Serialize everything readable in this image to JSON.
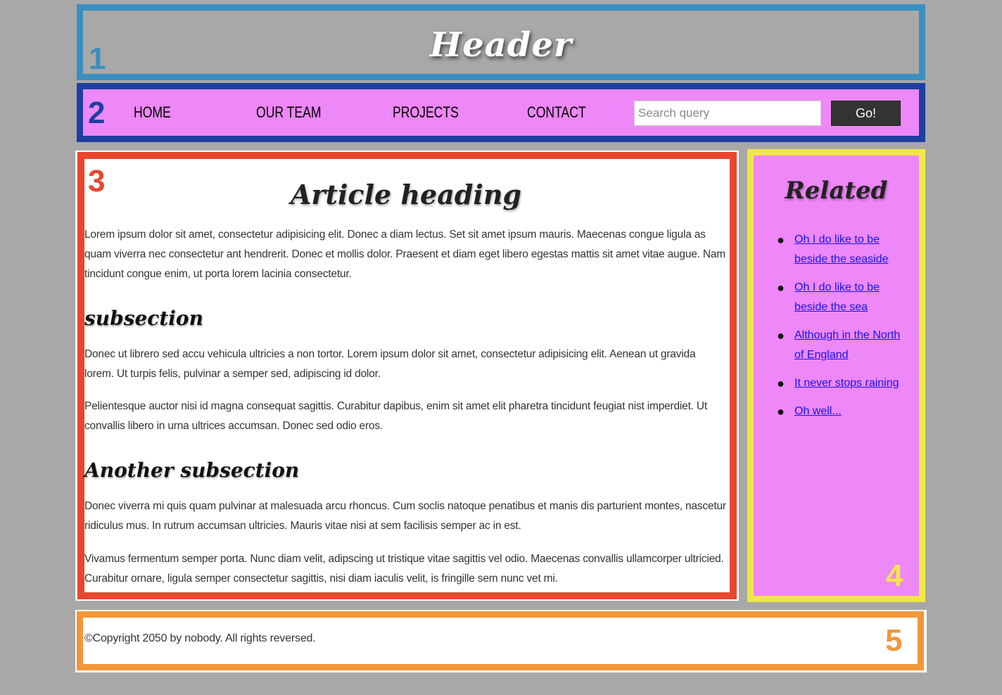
{
  "header": {
    "title": "Header",
    "region_number": "1"
  },
  "nav": {
    "region_number": "2",
    "links": [
      "HOME",
      "OUR TEAM",
      "PROJECTS",
      "CONTACT"
    ],
    "search_placeholder": "Search query",
    "search_value": "",
    "button_label": "Go!"
  },
  "article": {
    "region_number": "3",
    "title": "Article heading",
    "intro": "Lorem ipsum dolor sit amet, consectetur adipisicing elit. Donec a diam lectus. Set sit amet ipsum mauris. Maecenas congue ligula as quam viverra nec consectetur ant hendrerit. Donec et mollis dolor. Praesent et diam eget libero egestas mattis sit amet vitae augue. Nam tincidunt congue enim, ut porta lorem lacinia consectetur.",
    "subsection_1": {
      "title": "subsection",
      "paragraphs": [
        "Donec ut librero sed accu vehicula ultricies a non tortor. Lorem ipsum dolor sit amet, consectetur adipisicing elit. Aenean ut gravida lorem. Ut turpis felis, pulvinar a semper sed, adipiscing id dolor.",
        "Pelientesque auctor nisi id magna consequat sagittis. Curabitur dapibus, enim sit amet elit pharetra tincidunt feugiat nist imperdiet. Ut convallis libero in urna ultrices accumsan. Donec sed odio eros."
      ]
    },
    "subsection_2": {
      "title": "Another subsection",
      "paragraphs": [
        "Donec viverra mi quis quam pulvinar at malesuada arcu rhoncus. Cum soclis natoque penatibus et manis dis parturient montes, nascetur ridiculus mus. In rutrum accumsan ultricies. Mauris vitae nisi at sem facilisis semper ac in est.",
        "Vivamus fermentum semper porta. Nunc diam velit, adipscing ut tristique vitae sagittis vel odio. Maecenas convallis ullamcorper ultricied. Curabitur ornare, ligula semper consectetur sagittis, nisi diam iaculis velit, is fringille sem nunc vet mi."
      ]
    }
  },
  "aside": {
    "region_number": "4",
    "title": "Related",
    "links": [
      "Oh I do like to be beside the seaside",
      "Oh I do like to be beside the sea",
      "Although in the North of England",
      "It never stops raining",
      "Oh well..."
    ]
  },
  "footer": {
    "region_number": "5",
    "copyright": "©Copyright 2050 by nobody. All rights reversed."
  },
  "colors": {
    "page_background": "#a8a8a8",
    "header_border": "#3b8fbf",
    "nav_border": "#1d3fa0",
    "nav_background": "#ee87f7",
    "article_border": "#e8472e",
    "aside_border": "#f0e64a",
    "aside_background": "#ee87f7",
    "footer_border": "#f2973a",
    "link": "#1515ee"
  }
}
